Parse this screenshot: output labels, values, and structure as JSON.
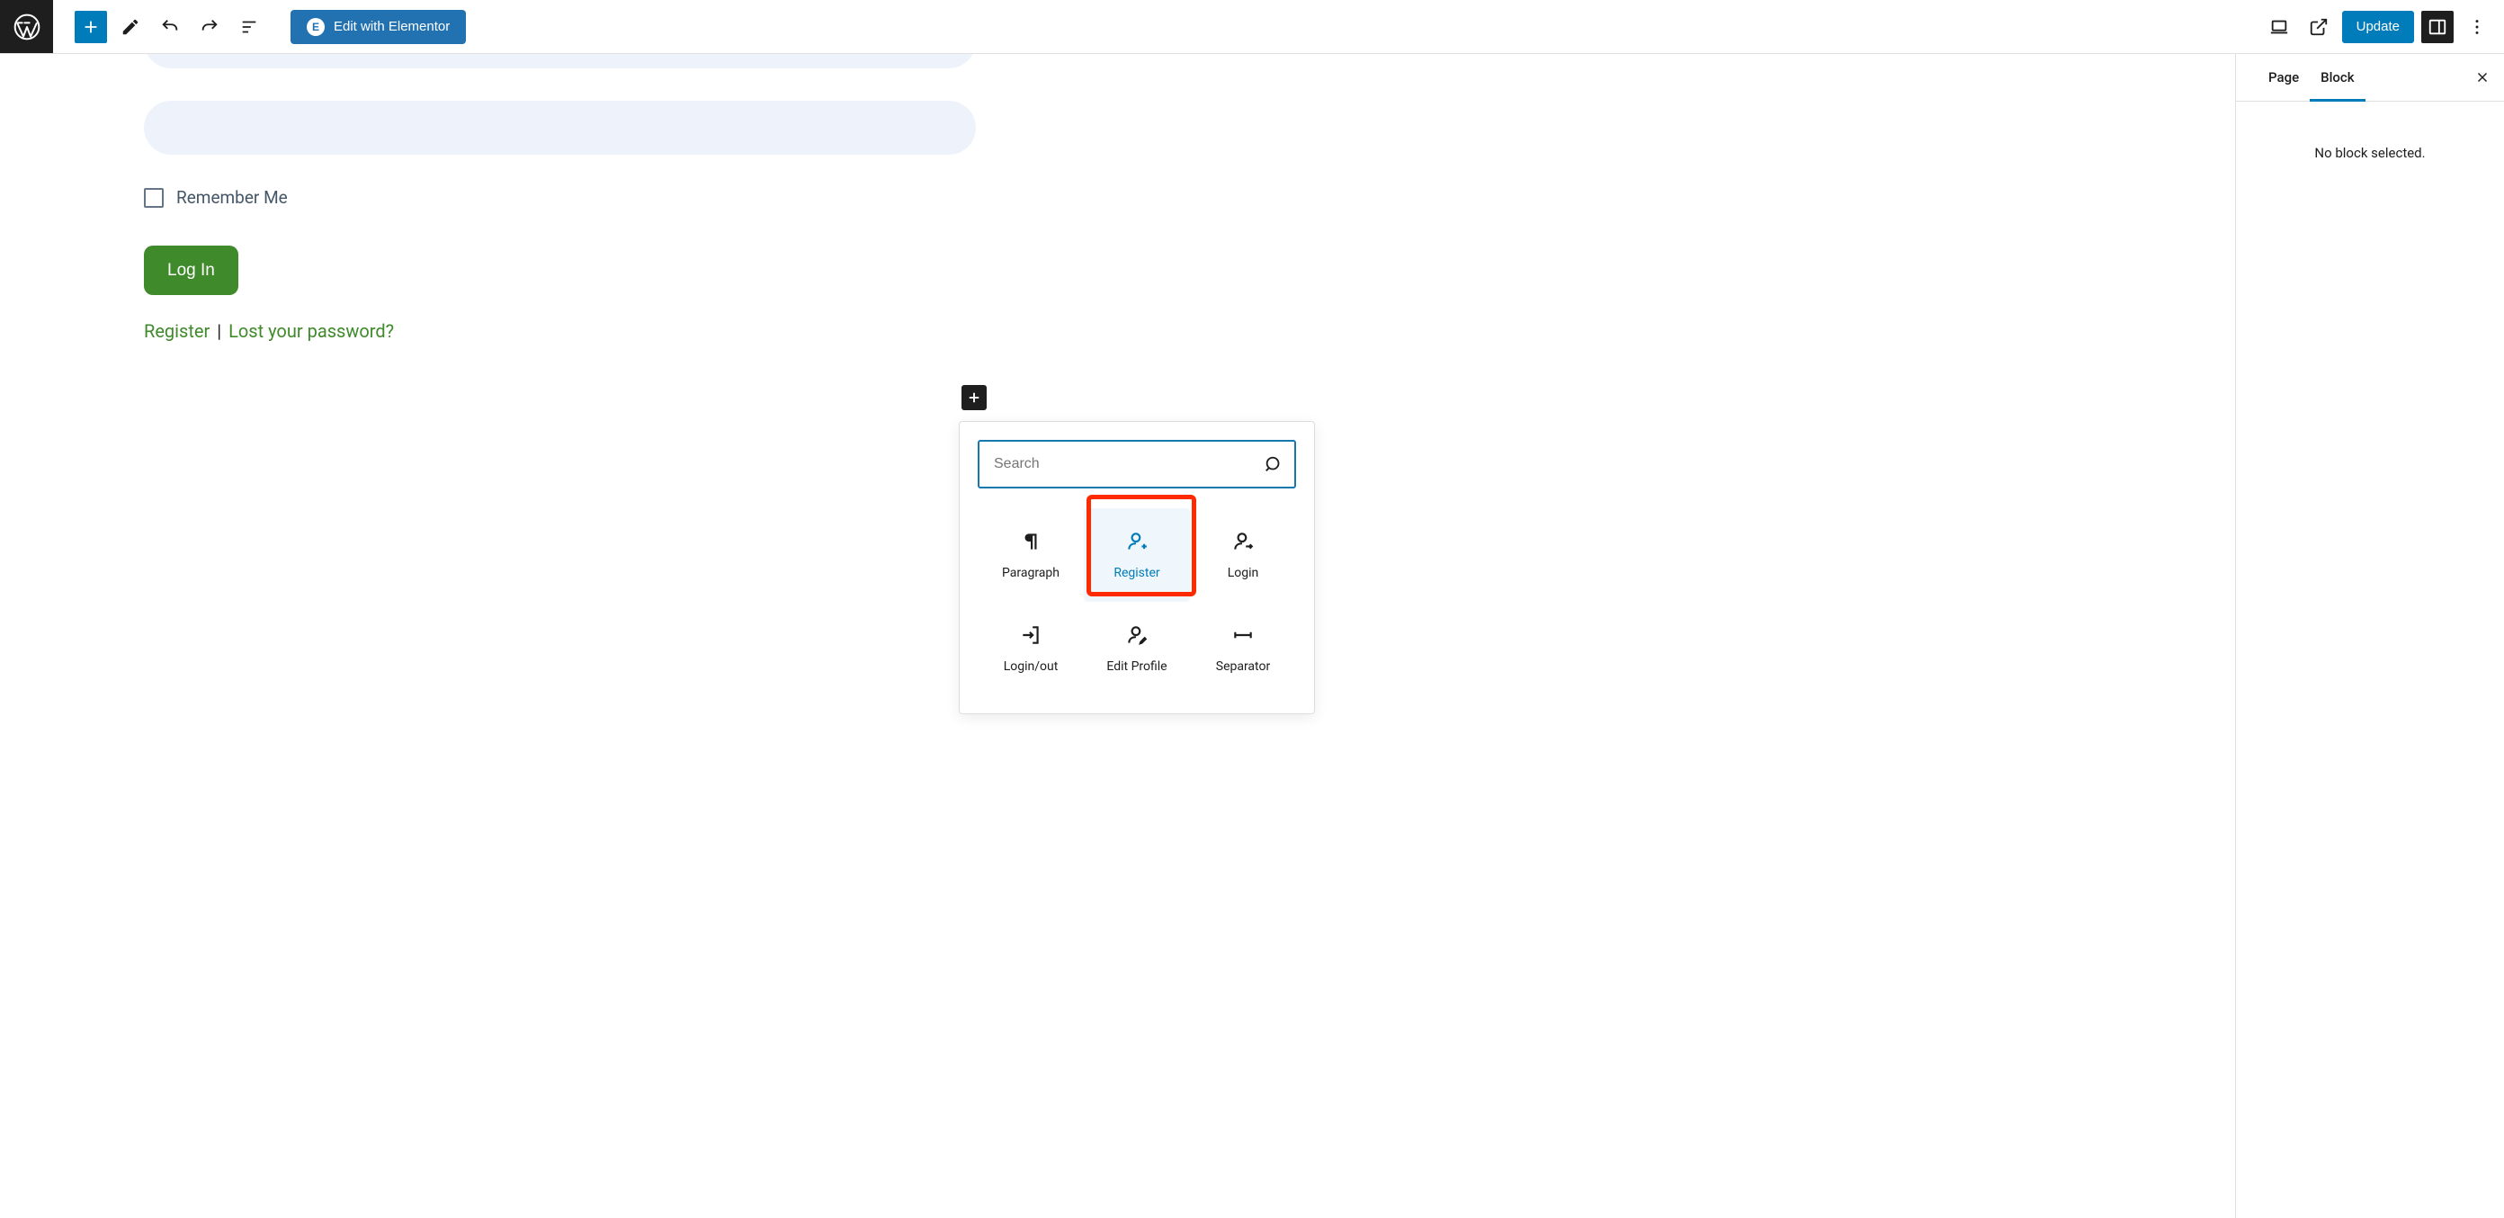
{
  "toolbar": {
    "elementor_label": "Edit with Elementor",
    "update_label": "Update"
  },
  "sidebar": {
    "tabs": {
      "page": "Page",
      "block": "Block"
    },
    "message": "No block selected."
  },
  "form": {
    "remember_label": "Remember Me",
    "login_button": "Log In",
    "register_link": "Register",
    "separator": "|",
    "lost_password_link": "Lost your password?"
  },
  "popover": {
    "search_placeholder": "Search",
    "blocks": [
      {
        "label": "Paragraph"
      },
      {
        "label": "Register"
      },
      {
        "label": "Login"
      },
      {
        "label": "Login/out"
      },
      {
        "label": "Edit Profile"
      },
      {
        "label": "Separator"
      }
    ]
  },
  "colors": {
    "accent": "#007cba",
    "green": "#3f8a2a",
    "highlight": "#ff2a00"
  }
}
